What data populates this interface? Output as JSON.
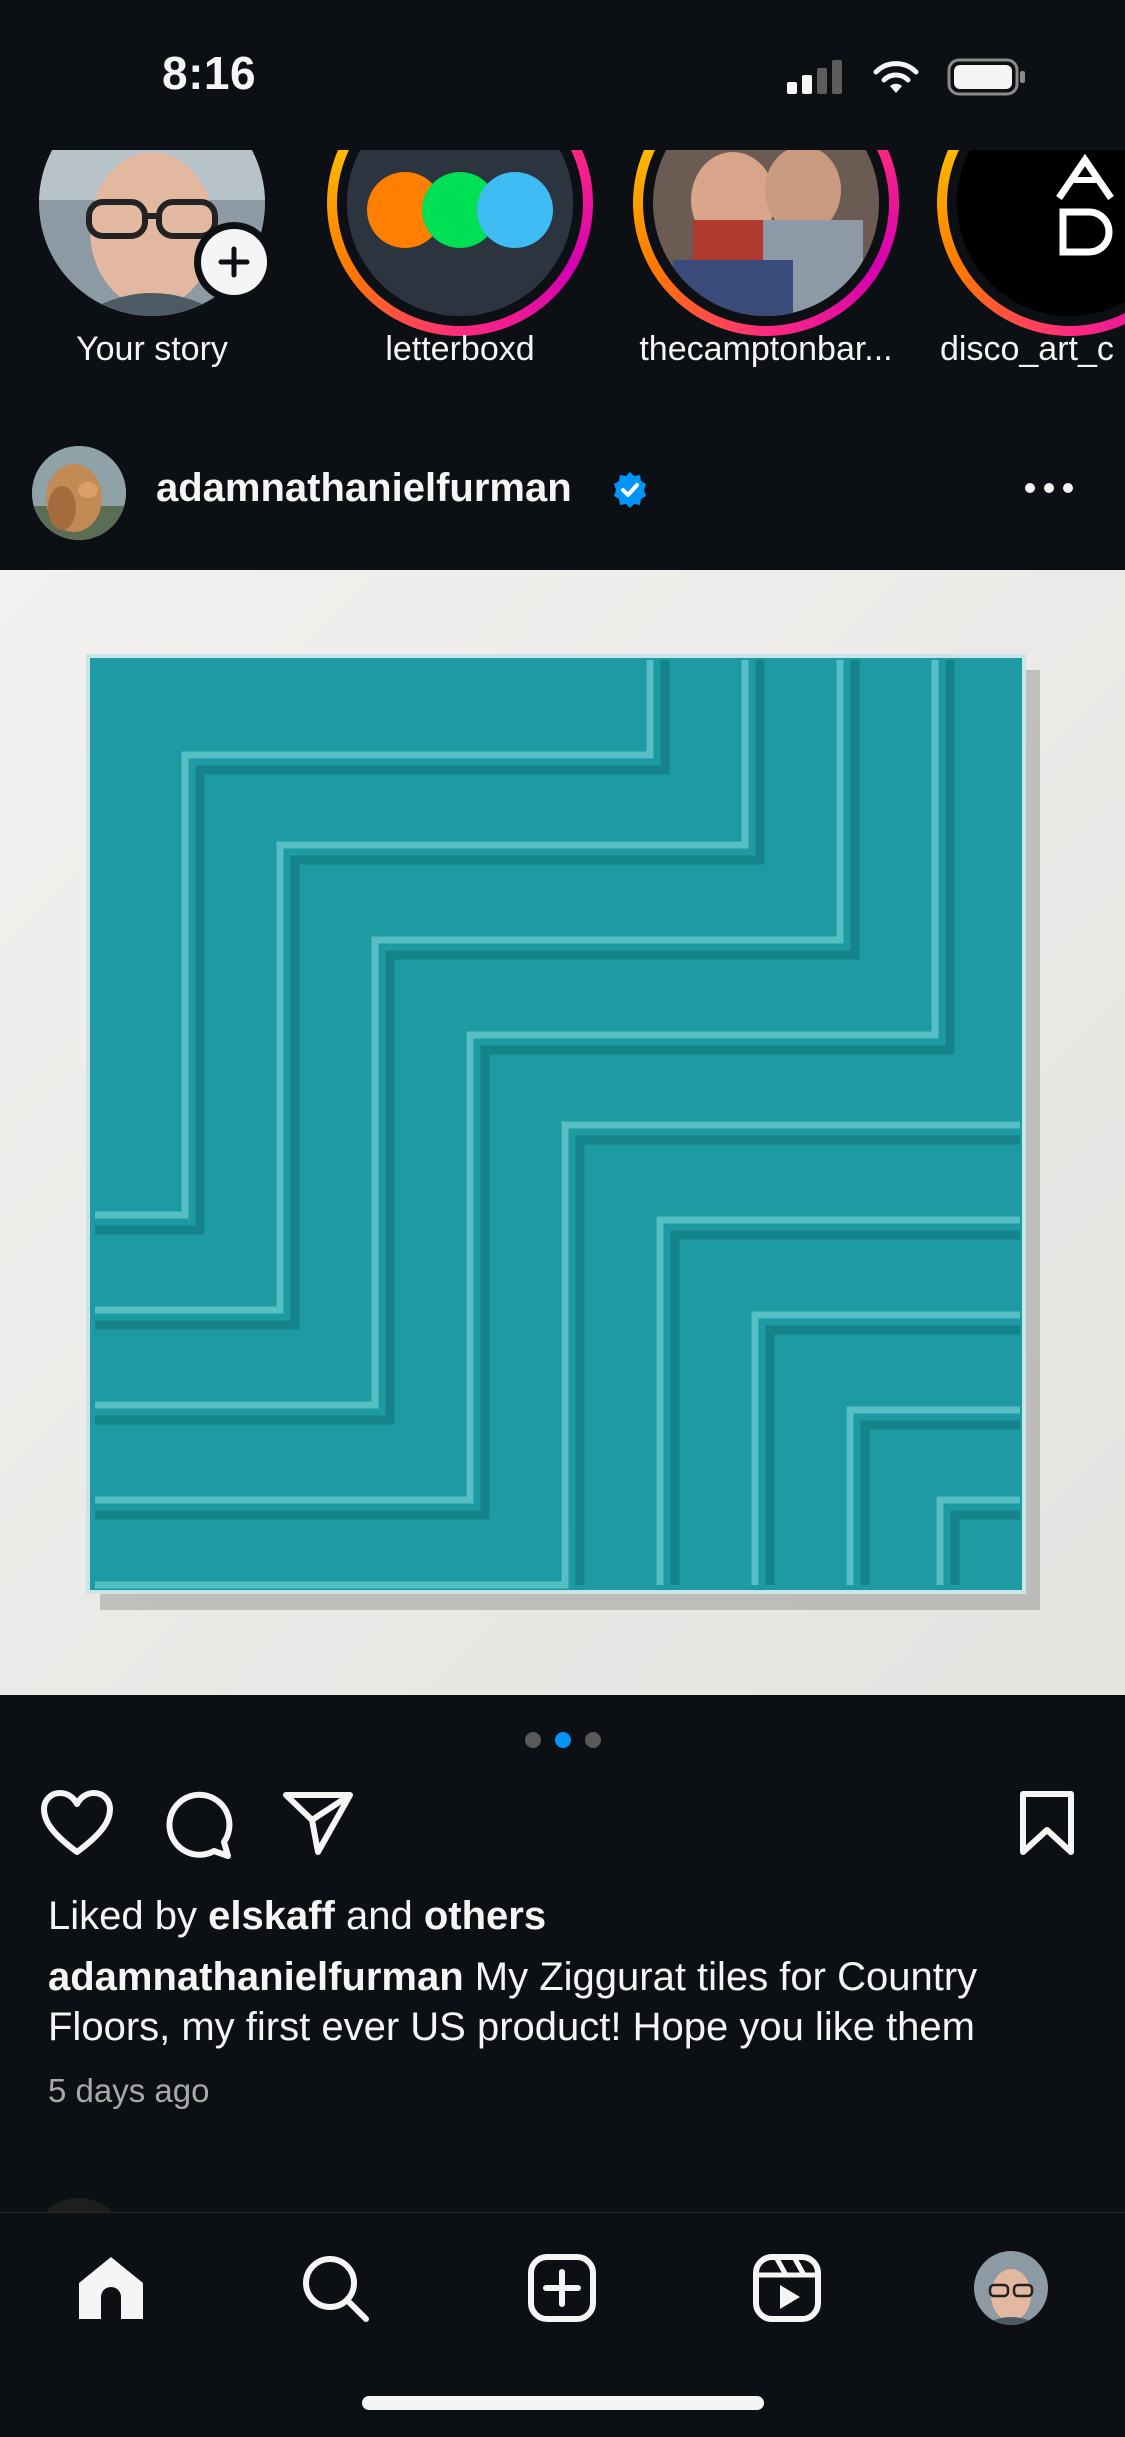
{
  "status_bar": {
    "time": "8:16"
  },
  "stories": [
    {
      "label": "Your story",
      "type": "own"
    },
    {
      "label": "letterboxd",
      "type": "unseen"
    },
    {
      "label": "thecamptonbar...",
      "type": "unseen"
    },
    {
      "label": "disco_art_c",
      "type": "unseen"
    }
  ],
  "post": {
    "username": "adamnathanielfurman",
    "verified_icon": "verified-badge-icon",
    "carousel": {
      "count": 3,
      "active_index": 1
    },
    "likes": {
      "prefix": "Liked by",
      "user": "elskaff",
      "joiner": "and",
      "others": "others"
    },
    "caption": {
      "username": "adamnathanielfurman",
      "text": " My Ziggurat tiles for Country Floors, my first ever US product! Hope you like them"
    },
    "time_ago": "5 days ago"
  },
  "colors": {
    "background": "#0c1014",
    "accent": "#0095f6",
    "tile": "#1a9aa1",
    "secondary_text": "#a8a8a8"
  },
  "tab_bar": [
    "home-icon",
    "search-icon",
    "create-icon",
    "reels-icon",
    "profile-avatar"
  ]
}
